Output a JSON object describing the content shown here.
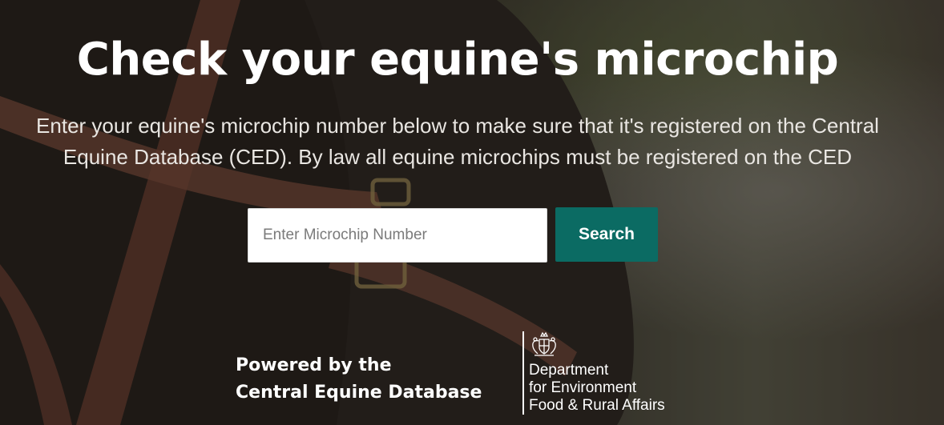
{
  "hero": {
    "title": "Check your equine's microchip",
    "subtitle_line1": "Enter your equine's microchip number below to make sure that it's registered on the Central",
    "subtitle_line2": "Equine Database (CED). By law all equine microchips must be registered on the CED"
  },
  "search": {
    "placeholder": "Enter Microchip Number",
    "value": "",
    "button_label": "Search"
  },
  "footer": {
    "powered_line1": "Powered by the",
    "powered_line2": "Central Equine Database",
    "defra_line1": "Department",
    "defra_line2": "for Environment",
    "defra_line3": "Food & Rural Affairs"
  },
  "colors": {
    "accent": "#0b6b63",
    "text": "#ffffff"
  },
  "icons": {
    "crest": "royal-coat-of-arms-icon"
  }
}
